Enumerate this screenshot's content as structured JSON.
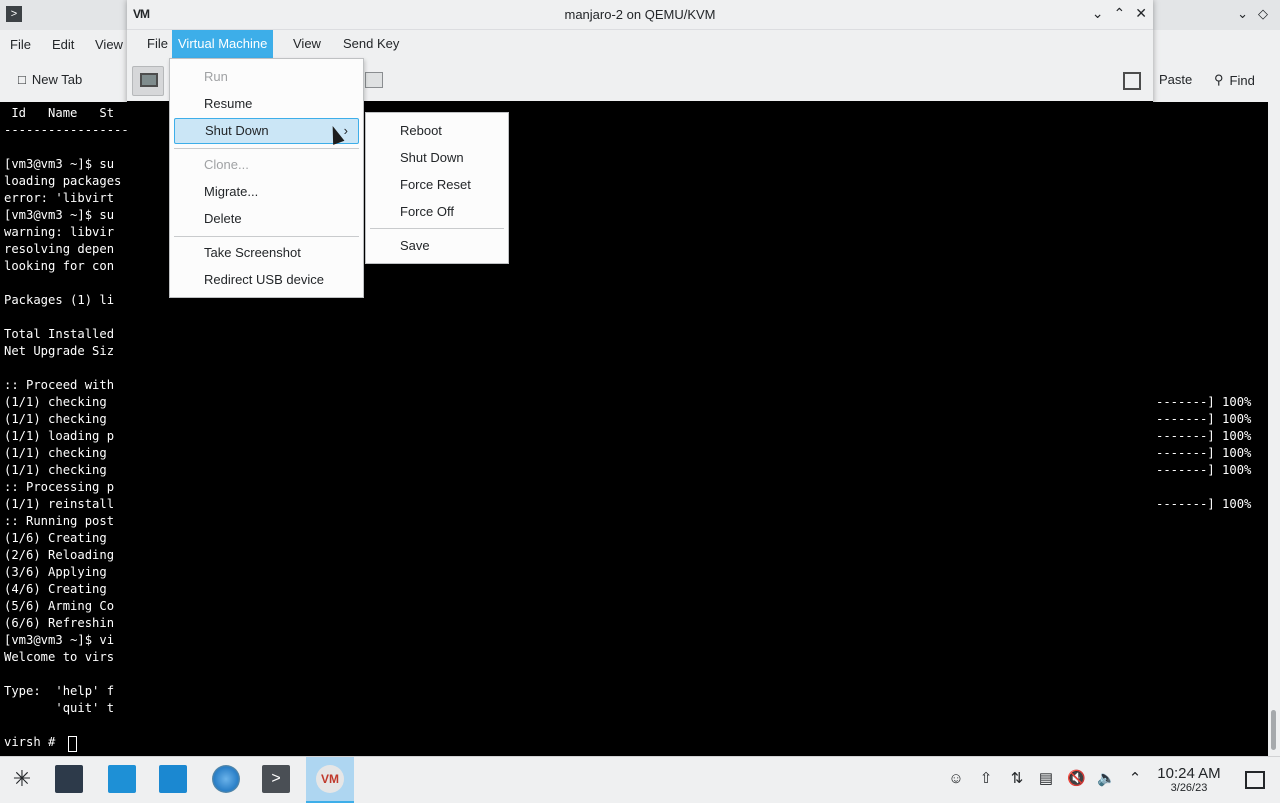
{
  "konsole": {
    "menu": [
      "File",
      "Edit",
      "View"
    ],
    "toolbar": {
      "new_tab": "New Tab",
      "paste": "Paste",
      "find": "Find"
    },
    "lines": [
      " Id   Name   St",
      "-------------------",
      "",
      "[vm3@vm3 ~]$ su",
      "loading packages",
      "error: 'libvirt",
      "[vm3@vm3 ~]$ su",
      "warning: libvir",
      "resolving depen",
      "looking for con",
      "",
      "Packages (1) li",
      "",
      "Total Installed",
      "Net Upgrade Siz",
      "",
      ":: Proceed with",
      "(1/1) checking",
      "(1/1) checking",
      "(1/1) loading p",
      "(1/1) checking",
      "(1/1) checking",
      ":: Processing p",
      "(1/1) reinstall",
      ":: Running post",
      "(1/6) Creating",
      "(2/6) Reloading",
      "(3/6) Applying",
      "(4/6) Creating",
      "(5/6) Arming Co",
      "(6/6) Refreshin",
      "[vm3@vm3 ~]$ vi",
      "Welcome to virs",
      "",
      "Type:  'help' f",
      "       'quit' t",
      "",
      "virsh # "
    ],
    "progress_lines": [
      {
        "row": 17,
        "text": "-------] 100%"
      },
      {
        "row": 18,
        "text": "-------] 100%"
      },
      {
        "row": 19,
        "text": "-------] 100%"
      },
      {
        "row": 20,
        "text": "-------] 100%"
      },
      {
        "row": 21,
        "text": "-------] 100%"
      },
      {
        "row": 23,
        "text": "-------] 100%"
      }
    ]
  },
  "vm_window": {
    "title": "manjaro-2 on QEMU/KVM",
    "menu": {
      "file": "File",
      "virtual_machine": "Virtual Machine",
      "view": "View",
      "send_key": "Send Key"
    }
  },
  "vm_menu": {
    "items": [
      {
        "label": "Run",
        "disabled": true
      },
      {
        "label": "Resume",
        "disabled": false
      },
      {
        "label": "Shut Down",
        "disabled": false,
        "highlighted": true,
        "submenu": true
      },
      {
        "label": "Clone...",
        "disabled": true
      },
      {
        "label": "Migrate...",
        "disabled": false
      },
      {
        "label": "Delete",
        "disabled": false
      },
      {
        "label": "Take Screenshot",
        "disabled": false
      },
      {
        "label": "Redirect USB device",
        "disabled": false
      }
    ]
  },
  "shutdown_submenu": {
    "items": [
      "Reboot",
      "Shut Down",
      "Force Reset",
      "Force Off",
      "Save"
    ]
  },
  "taskbar": {
    "clock_time": "10:24 AM",
    "clock_date": "3/26/23",
    "apps": [
      "app-launcher-icon",
      "system-settings-icon",
      "software-store-icon",
      "file-manager-icon",
      "web-browser-icon",
      "terminal-icon",
      "virt-manager-icon"
    ],
    "tray": [
      "user-icon",
      "updates-icon",
      "network-icon",
      "clipboard-icon",
      "muted-icon",
      "volume-icon",
      "tray-expand-icon"
    ]
  }
}
